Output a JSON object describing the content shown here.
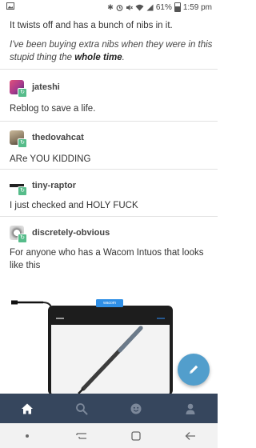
{
  "status_bar": {
    "battery_text": "61%",
    "time": "1:59 pm",
    "icons": [
      "image-icon",
      "bluetooth-icon",
      "alarm-icon",
      "mute-icon",
      "wifi-icon",
      "signal-icon",
      "battery-icon"
    ]
  },
  "post": {
    "quoted_text": "It twists off and has a bunch of nibs in it.",
    "italic_text_start": "I've been buying extra nibs when they were in this stupid thing the ",
    "italic_text_bold": "whole time",
    "italic_text_end": "."
  },
  "reblogs": [
    {
      "username": "jateshi",
      "text": "Reblog to save a life."
    },
    {
      "username": "thedovahcat",
      "text": "ARe YOU KIDDING"
    },
    {
      "username": "tiny-raptor",
      "text": "I just checked and HOLY FUCK"
    },
    {
      "username": "discretely-obvious",
      "text": "For anyone who has a Wacom Intuos that looks like this"
    }
  ],
  "image": {
    "brand_label": "wacom"
  },
  "fab": {
    "icon": "pencil-icon"
  },
  "tabbar": {
    "tabs": [
      "home-icon",
      "search-icon",
      "activity-icon",
      "account-icon"
    ],
    "active": "home-icon"
  },
  "navbar": {
    "buttons": [
      "nav-dot-icon",
      "recent-apps-icon",
      "home-square-icon",
      "back-icon"
    ]
  },
  "colors": {
    "tabbar_bg": "#36465d",
    "fab_bg": "#529ecc",
    "reblog_badge": "#56bc8a"
  }
}
